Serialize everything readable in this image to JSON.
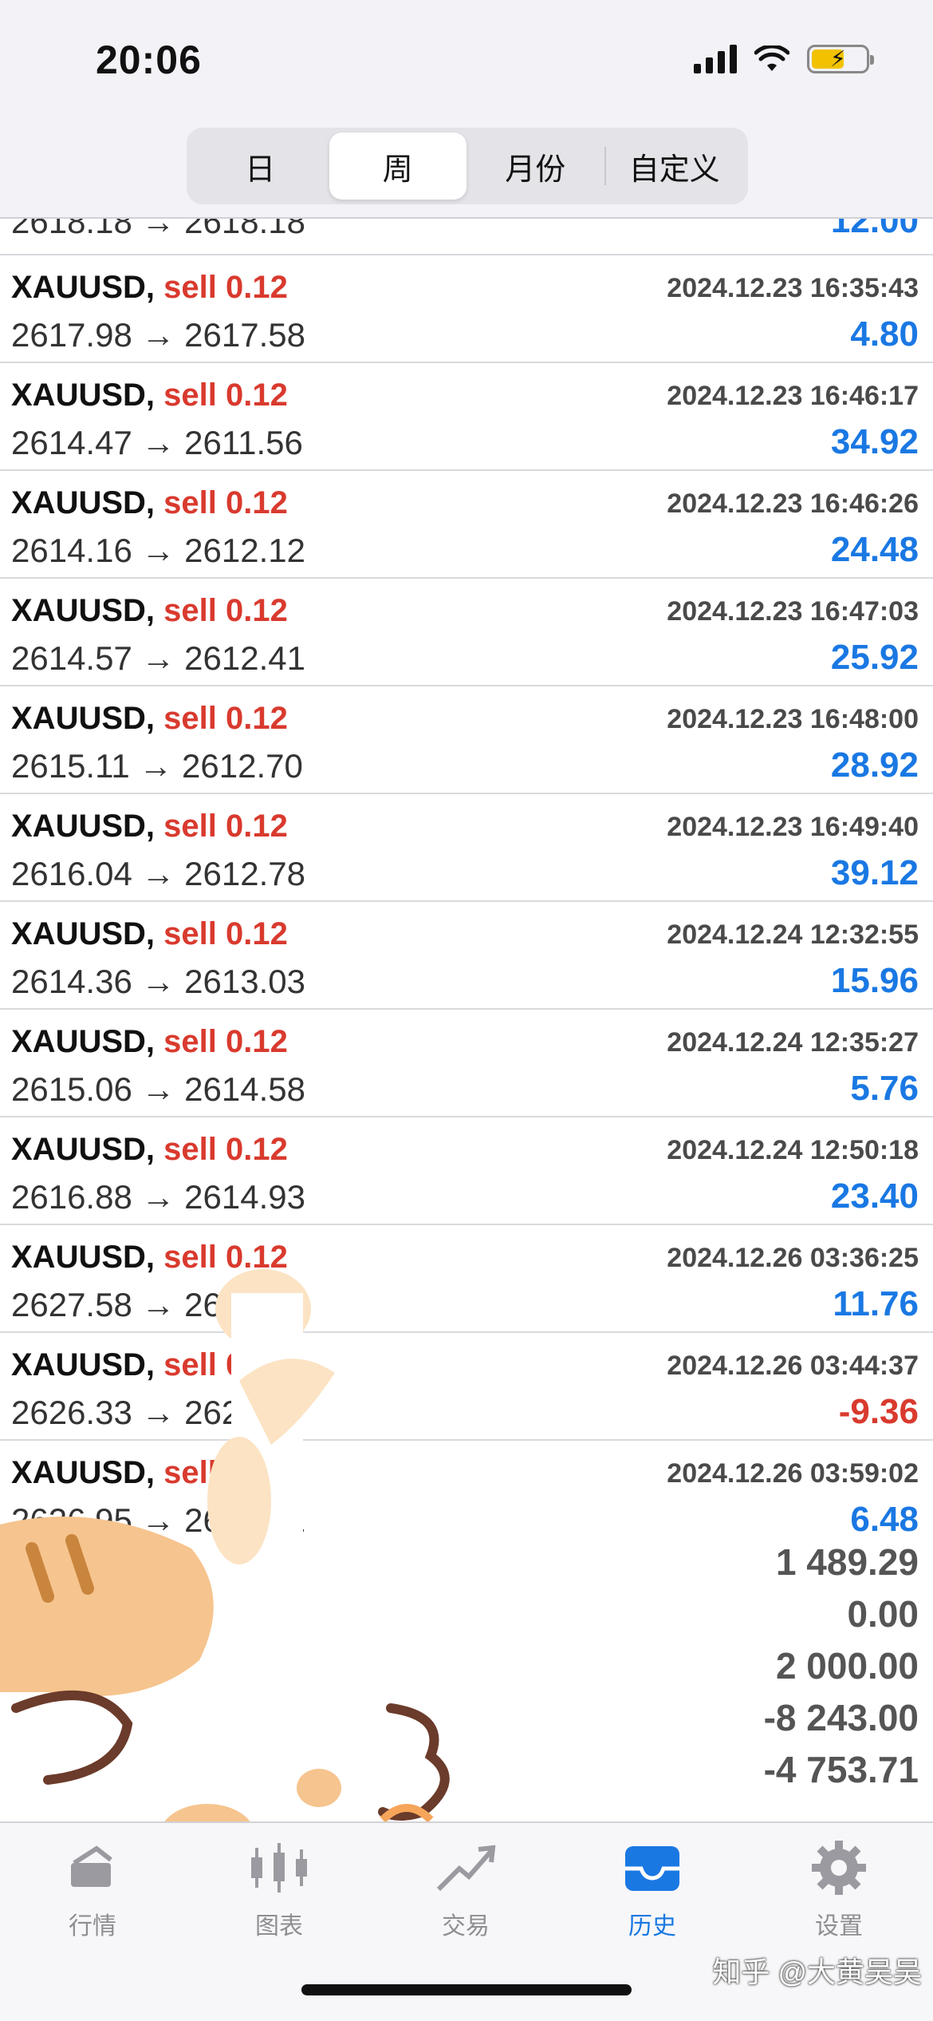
{
  "status_bar": {
    "time": "20:06"
  },
  "segments": [
    {
      "label": "日",
      "active": false
    },
    {
      "label": "周",
      "active": true
    },
    {
      "label": "月份",
      "active": false
    },
    {
      "label": "自定义",
      "active": false
    }
  ],
  "partial_top_row": {
    "prices": "2618.18 → 2618.18",
    "profit": "12.00"
  },
  "trades": [
    {
      "symbol": "XAUUSD,",
      "side": "sell 0.12",
      "time": "2024.12.23 16:35:43",
      "prices": "2617.98 → 2617.58",
      "profit": "4.80",
      "negative": false
    },
    {
      "symbol": "XAUUSD,",
      "side": "sell 0.12",
      "time": "2024.12.23 16:46:17",
      "prices": "2614.47 → 2611.56",
      "profit": "34.92",
      "negative": false
    },
    {
      "symbol": "XAUUSD,",
      "side": "sell 0.12",
      "time": "2024.12.23 16:46:26",
      "prices": "2614.16 → 2612.12",
      "profit": "24.48",
      "negative": false
    },
    {
      "symbol": "XAUUSD,",
      "side": "sell 0.12",
      "time": "2024.12.23 16:47:03",
      "prices": "2614.57 → 2612.41",
      "profit": "25.92",
      "negative": false
    },
    {
      "symbol": "XAUUSD,",
      "side": "sell 0.12",
      "time": "2024.12.23 16:48:00",
      "prices": "2615.11 → 2612.70",
      "profit": "28.92",
      "negative": false
    },
    {
      "symbol": "XAUUSD,",
      "side": "sell 0.12",
      "time": "2024.12.23 16:49:40",
      "prices": "2616.04 → 2612.78",
      "profit": "39.12",
      "negative": false
    },
    {
      "symbol": "XAUUSD,",
      "side": "sell 0.12",
      "time": "2024.12.24 12:32:55",
      "prices": "2614.36 → 2613.03",
      "profit": "15.96",
      "negative": false
    },
    {
      "symbol": "XAUUSD,",
      "side": "sell 0.12",
      "time": "2024.12.24 12:35:27",
      "prices": "2615.06 → 2614.58",
      "profit": "5.76",
      "negative": false
    },
    {
      "symbol": "XAUUSD,",
      "side": "sell 0.12",
      "time": "2024.12.24 12:50:18",
      "prices": "2616.88 → 2614.93",
      "profit": "23.40",
      "negative": false
    },
    {
      "symbol": "XAUUSD,",
      "side": "sell 0.12",
      "time": "2024.12.26 03:36:25",
      "prices": "2627.58 → 2626.60",
      "profit": "11.76",
      "negative": false
    },
    {
      "symbol": "XAUUSD,",
      "side": "sell 0.12",
      "time": "2024.12.26 03:44:37",
      "prices": "2626.33 → 2627.11",
      "profit": "-9.36",
      "negative": true
    },
    {
      "symbol": "XAUUSD,",
      "side": "sell 0.12",
      "time": "2024.12.26 03:59:02",
      "prices": "2626.95 → 2626.41",
      "profit": "6.48",
      "negative": false
    }
  ],
  "summary": [
    "1 489.29",
    "0.00",
    "2 000.00",
    "-8 243.00",
    "-4 753.71"
  ],
  "tabs": [
    {
      "label": "行情",
      "icon": "quotes-icon",
      "active": false
    },
    {
      "label": "图表",
      "icon": "candlestick-chart-icon",
      "active": false
    },
    {
      "label": "交易",
      "icon": "trade-trend-icon",
      "active": false
    },
    {
      "label": "历史",
      "icon": "history-tray-icon",
      "active": true
    },
    {
      "label": "设置",
      "icon": "gear-icon",
      "active": false
    }
  ],
  "watermark": "知乎 @大黄吴吴",
  "colors": {
    "accent": "#1a78e3",
    "sell": "#d93a2e",
    "negative": "#d93a2e"
  }
}
